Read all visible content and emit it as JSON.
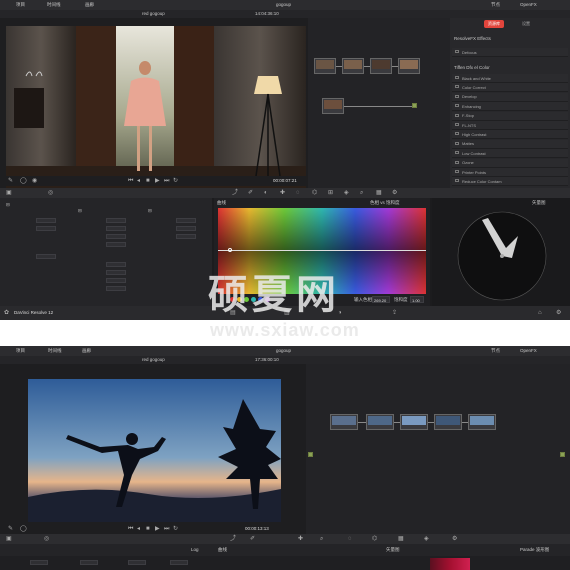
{
  "top": {
    "menu": [
      "项目",
      "时间线",
      "画廊"
    ],
    "project_title": "gogoup",
    "clip_name": "red gogoup",
    "timecode_top": "14:04:36:10",
    "mode_label": "节点",
    "tabs": [
      "OpenFX"
    ],
    "viewer_timecode": "00:00:07:21",
    "resolve_logo_text": "DaVinci Resolve 12",
    "fx_tab_active": "资源库",
    "fx_tab_other": "设置",
    "fx_header1": "ResolveFX Effects",
    "fx_item_1": "Defocus",
    "fx_header2": "Tiffen Dfx el Color",
    "fx_items": [
      "Black and White",
      "Color Correct",
      "Develop",
      "Enhancing",
      "F-Stop",
      "FL-NTS",
      "High Contrast",
      "Mattes",
      "Low Contrast",
      "Ozone",
      "Printer Points",
      "Reduce Color Contam"
    ],
    "curves_title": "曲线",
    "scopes_title": "矢量图",
    "hue_label": "色相 vs 饱和度",
    "input_hue_label": "输入色相",
    "input_hue_value": "269.20",
    "sat_label": "饱和度",
    "sat_value": "1.00",
    "colors": {
      "accent_red": "#e2453c",
      "node_green": "#8ba256",
      "panel_bg": "#1c1c1e"
    }
  },
  "bottom": {
    "menu": [
      "项目",
      "时间线",
      "画廊"
    ],
    "project_title": "gogoup",
    "clip_name": "red gogoup",
    "timecode_top": "17:36:00:10",
    "mode_label": "节点",
    "tabs": [
      "OpenFX"
    ],
    "viewer_timecode": "00:00:13:13",
    "curves_title": "曲线",
    "scope_label": "矢量图",
    "log_label": "Log",
    "scopes_mode": "Parade 波形图"
  },
  "watermark": {
    "title": "硕夏网",
    "url": "www.sxiaw.com"
  }
}
